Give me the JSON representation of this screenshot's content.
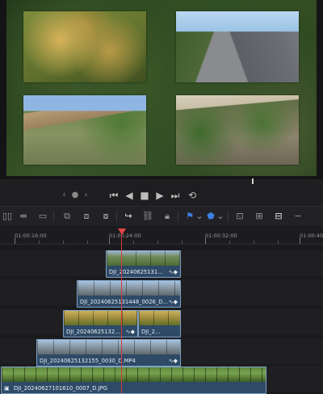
{
  "transport": {
    "jog": "‹ ● ›",
    "buttons": [
      "⏮",
      "◀",
      "■",
      "▶",
      "⏭",
      "⟲"
    ]
  },
  "toolbar": {
    "icons": [
      "trim-icon",
      "dynamic-trim-icon",
      "blade-icon",
      "insert-icon",
      "overwrite-icon",
      "replace-icon",
      "snapping-icon",
      "linked-selection-icon",
      "lock-icon",
      "flag-icon",
      "marker-icon",
      "zoom-full-icon",
      "zoom-detail-icon",
      "zoom-custom-icon"
    ]
  },
  "ruler": {
    "labels": [
      "01:00:16:00",
      "01:00:24:00",
      "01:00:32:00",
      "01:00:40:0"
    ]
  },
  "clips": [
    {
      "name": "DJI_20240625131..."
    },
    {
      "name": "DJI_20240625131448_0026_D..."
    },
    {
      "name": "DJI_20240625132..."
    },
    {
      "name": "DJI_2..."
    },
    {
      "name": "DJI_20240625132155_0030_D.MP4"
    },
    {
      "name": "DJI_20240627101610_0007_D.JPG"
    }
  ],
  "colors": {
    "accent": "#3d7fe0",
    "playhead": "#e04444",
    "clip_fill": "#2e4a66",
    "clip_border": "#7fa2c8"
  }
}
